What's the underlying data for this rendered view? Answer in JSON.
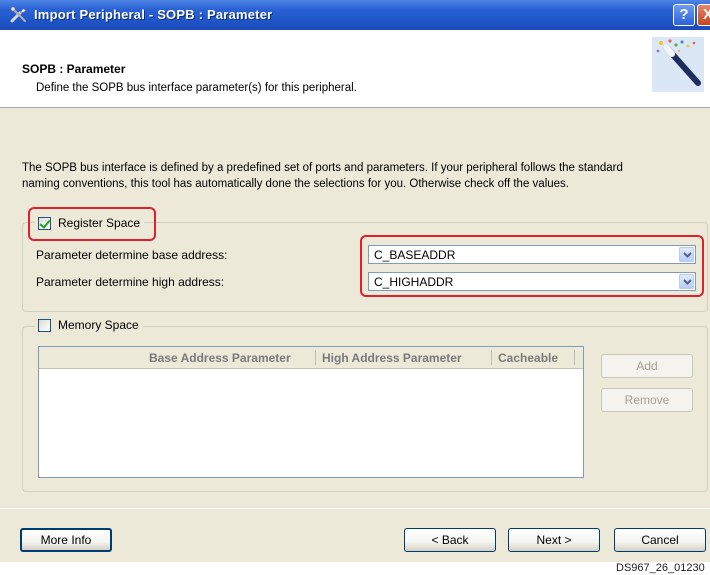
{
  "window": {
    "title": "Import Peripheral - SOPB : Parameter",
    "help_glyph": "?",
    "close_glyph": "X",
    "app_icon": "tools-icon"
  },
  "header": {
    "title": "SOPB : Parameter",
    "description": "Define the SOPB bus interface parameter(s) for this peripheral.",
    "icon": "magic-wand-icon"
  },
  "intro": {
    "line1": "The SOPB bus interface is defined by a predefined set of ports and parameters. If your peripheral follows the standard",
    "line2": "naming conventions, this tool has automatically done the selections for you. Otherwise check off the values."
  },
  "register_space": {
    "label": "Register Space",
    "checked": true,
    "base_label": "Parameter determine base address:",
    "base_value": "C_BASEADDR",
    "high_label": "Parameter determine high address:",
    "high_value": "C_HIGHADDR"
  },
  "memory_space": {
    "label": "Memory Space",
    "checked": false,
    "columns": [
      "Base Address Parameter",
      "High Address Parameter",
      "Cacheable"
    ],
    "rows": [],
    "add_label": "Add",
    "remove_label": "Remove"
  },
  "footer": {
    "more_info": "More Info",
    "back": "< Back",
    "next": "Next >",
    "cancel": "Cancel"
  },
  "caption": "DS967_26_01230",
  "colors": {
    "highlight": "#e0202a",
    "titlebar": "#2b63d6",
    "dialog_bg": "#ece9d8"
  }
}
